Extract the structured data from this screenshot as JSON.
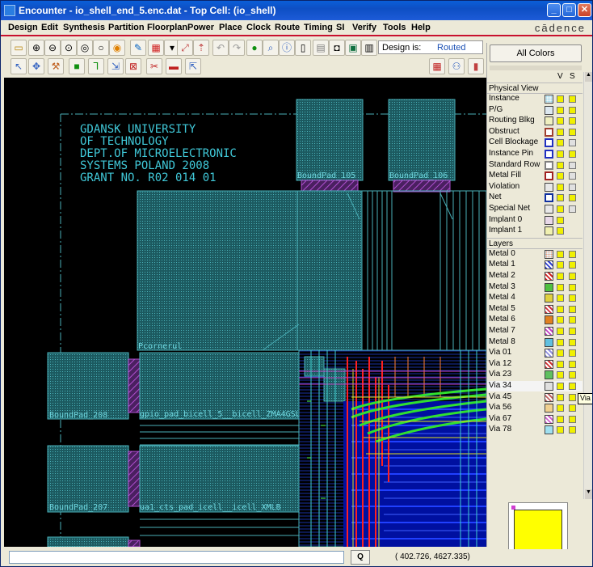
{
  "window": {
    "title": "Encounter - io_shell_end_5.enc.dat - Top Cell: (io_shell)"
  },
  "menu": [
    "Design",
    "Edit",
    "Synthesis",
    "Partition",
    "Floorplan",
    "Power",
    "Place",
    "Clock",
    "Route",
    "Timing",
    "SI",
    "Verify",
    "Tools",
    "Help"
  ],
  "brand": "cādence",
  "design_status": {
    "label": "Design is:",
    "value": "Routed"
  },
  "canvas": {
    "header_lines": [
      "GDANSK UNIVERSITY",
      "OF TECHNOLOGY",
      "DEPT.OF MICROELECTRONIC",
      "SYSTEMS POLAND 2008",
      "GRANT NO. R02 014 01"
    ],
    "labels": {
      "pad105": "BoundPad_105",
      "pad106": "BoundPad_106",
      "corner": "Pcornerul",
      "pad208": "BoundPad_208",
      "pad207": "BoundPad_207",
      "cell1": "gpio_pad_bicell_5__bicell_ZMA4GSLB",
      "cell2": "ua1_cts_pad_icell__icell_XMLB"
    }
  },
  "layer_panel": {
    "all_colors": "All Colors",
    "v_label": "V",
    "s_label": "S",
    "physical_title": "Physical View",
    "physical": [
      {
        "name": "Instance",
        "color": "#9fd8e8",
        "pattern": "dots",
        "s": "yellow"
      },
      {
        "name": "P/G",
        "color": "#dde8f0",
        "pattern": "solid",
        "s": "yellow"
      },
      {
        "name": "Routing Blkg",
        "color": "#f0f0c0",
        "pattern": "solid",
        "s": "yellow"
      },
      {
        "name": "Obstruct",
        "color": "#a04030",
        "pattern": "outline",
        "s": "yellow"
      },
      {
        "name": "Cell Blockage",
        "color": "#2030c0",
        "pattern": "outline",
        "s": "grey"
      },
      {
        "name": "Instance Pin",
        "color": "#2030c0",
        "pattern": "outline",
        "s": "yellow"
      },
      {
        "name": "Standard Row",
        "color": "#808080",
        "pattern": "outline",
        "s": "grey"
      },
      {
        "name": "Metal Fill",
        "color": "#a02020",
        "pattern": "outline",
        "s": "grey"
      },
      {
        "name": "Violation",
        "color": "#e8e8e8",
        "pattern": "solid",
        "s": "grey"
      },
      {
        "name": "Net",
        "color": "#1030a0",
        "pattern": "outline",
        "s": "yellow"
      },
      {
        "name": "Special Net",
        "color": "#e8e8e8",
        "pattern": "solid",
        "s": "grey"
      },
      {
        "name": "Implant 0",
        "color": "#e8d8e8",
        "pattern": "solid",
        "s": "none"
      },
      {
        "name": "Implant 1",
        "color": "#f0f0b0",
        "pattern": "solid",
        "s": "none"
      }
    ],
    "layers_title": "Layers",
    "layers": [
      {
        "name": "Metal 0",
        "color": "#e8a080",
        "pattern": "dots"
      },
      {
        "name": "Metal 1",
        "color": "#3040d0",
        "pattern": "hatch"
      },
      {
        "name": "Metal 2",
        "color": "#d02020",
        "pattern": "hatch"
      },
      {
        "name": "Metal 3",
        "color": "#50c040",
        "pattern": "solid"
      },
      {
        "name": "Metal 4",
        "color": "#e0d040",
        "pattern": "solid"
      },
      {
        "name": "Metal 5",
        "color": "#d03040",
        "pattern": "hatch"
      },
      {
        "name": "Metal 6",
        "color": "#e08020",
        "pattern": "solid"
      },
      {
        "name": "Metal 7",
        "color": "#c040c0",
        "pattern": "hatch"
      },
      {
        "name": "Metal 8",
        "color": "#60c0e0",
        "pattern": "solid"
      },
      {
        "name": "Via 01",
        "color": "#9090e0",
        "pattern": "hatch"
      },
      {
        "name": "Via 12",
        "color": "#d03030",
        "pattern": "hatch"
      },
      {
        "name": "Via 23",
        "color": "#60c060",
        "pattern": "solid"
      },
      {
        "name": "Via 34",
        "color": "#e0e0e0",
        "pattern": "solid"
      },
      {
        "name": "Via 45",
        "color": "#c06060",
        "pattern": "hatch"
      },
      {
        "name": "Via 56",
        "color": "#f0d090",
        "pattern": "solid"
      },
      {
        "name": "Via 67",
        "color": "#d060d0",
        "pattern": "hatch"
      },
      {
        "name": "Via 78",
        "color": "#a0e0f0",
        "pattern": "solid"
      }
    ],
    "tooltip": "Via"
  },
  "status": {
    "q_label": "Q",
    "coords": "(      402.726,    4627.335)"
  }
}
